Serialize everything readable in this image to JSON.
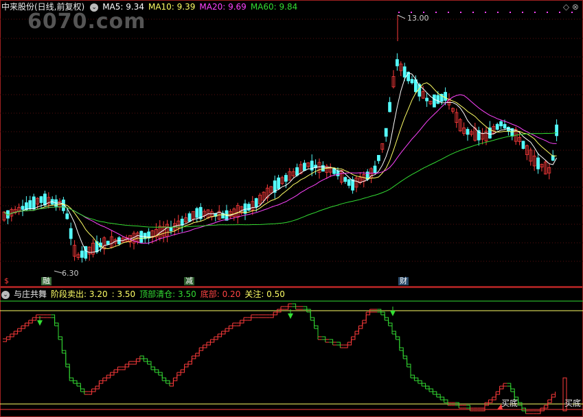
{
  "header": {
    "stock_title": "中来股份(日线,前复权)",
    "ma": [
      {
        "label": "MA5:",
        "value": "9.34",
        "color": "#ffffff"
      },
      {
        "label": "MA10:",
        "value": "9.39",
        "color": "#ffff66"
      },
      {
        "label": "MA20:",
        "value": "9.69",
        "color": "#ff44ff"
      },
      {
        "label": "MA60:",
        "value": "9.84",
        "color": "#33dd33"
      }
    ],
    "watermark": "6070.com",
    "window_icons": "◇ ⊗"
  },
  "price_labels": {
    "high": "13.00",
    "low": "6.30"
  },
  "bottom_marks": {
    "s": "$",
    "m1": "融",
    "m2": "减",
    "m3": "财"
  },
  "indicator": {
    "name": "与庄共舞",
    "items": [
      {
        "label": "阶段卖出:",
        "value": "3.20",
        "color": "#ffff66"
      },
      {
        "label": ":",
        "value": "3.50",
        "color": "#ffff66"
      },
      {
        "label": "顶部清仓:",
        "value": "3.50",
        "color": "#33dd33"
      },
      {
        "label": "底部:",
        "value": "0.20",
        "color": "#ff4444"
      },
      {
        "label": "关注:",
        "value": "0.50",
        "color": "#ffff66"
      }
    ],
    "buy_label_1": "买底",
    "buy_label_2": "买底"
  },
  "colors": {
    "up": "#ff3b3b",
    "down": "#54fcfc",
    "grid": "#a02020"
  }
}
